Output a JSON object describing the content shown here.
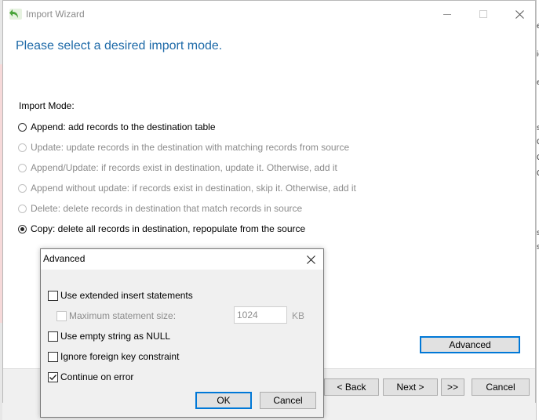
{
  "window": {
    "title": "Import Wizard",
    "controls": {
      "minimize": "—",
      "maximize": "☐",
      "close": "✕"
    }
  },
  "heading": "Please select a desired import mode.",
  "import_mode_label": "Import Mode:",
  "modes": [
    {
      "label": "Append: add records to the destination table",
      "enabled": true,
      "checked": false
    },
    {
      "label": "Update: update records in the destination with matching records from source",
      "enabled": false,
      "checked": false
    },
    {
      "label": "Append/Update: if records exist in destination, update it. Otherwise, add it",
      "enabled": false,
      "checked": false
    },
    {
      "label": "Append without update: if records exist in destination, skip it. Otherwise, add it",
      "enabled": false,
      "checked": false
    },
    {
      "label": "Delete: delete records in destination that match records in source",
      "enabled": false,
      "checked": false
    },
    {
      "label": "Copy: delete all records in destination, repopulate from the source",
      "enabled": true,
      "checked": true
    }
  ],
  "advanced_button": "Advanced",
  "footer": {
    "back": "< Back",
    "next": "Next >",
    "last": ">>",
    "cancel": "Cancel"
  },
  "advanced_dialog": {
    "title": "Advanced",
    "close": "✕",
    "options": {
      "extended_insert": {
        "label": "Use extended insert statements",
        "checked": false,
        "enabled": true
      },
      "max_statement_size": {
        "label": "Maximum statement size:",
        "checked": false,
        "enabled": false,
        "value": "1024",
        "unit": "KB"
      },
      "empty_string_null": {
        "label": "Use empty string as NULL",
        "checked": false,
        "enabled": true
      },
      "ignore_fk": {
        "label": "Ignore foreign key constraint",
        "checked": false,
        "enabled": true
      },
      "continue_on_error": {
        "label": "Continue on error",
        "checked": true,
        "enabled": true
      }
    },
    "ok": "OK",
    "cancel": "Cancel"
  },
  "background_fragments": [
    "e",
    "ic",
    "e",
    "s",
    "C",
    "C",
    "C",
    "s",
    "s"
  ]
}
